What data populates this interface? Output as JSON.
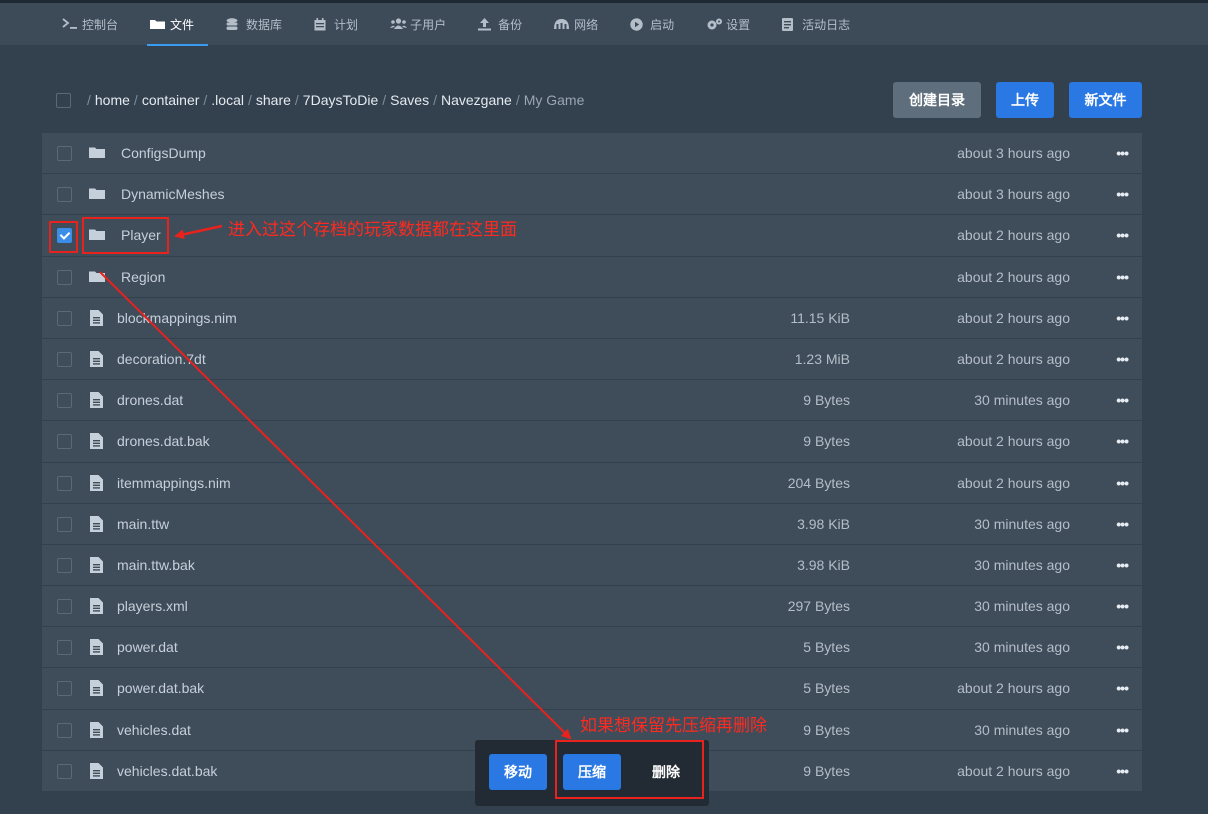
{
  "nav": [
    {
      "label": "控制台",
      "icon": "terminal-icon",
      "active": false
    },
    {
      "label": "文件",
      "icon": "folder-icon",
      "active": true
    },
    {
      "label": "数据库",
      "icon": "database-icon",
      "active": false
    },
    {
      "label": "计划",
      "icon": "calendar-icon",
      "active": false
    },
    {
      "label": "子用户",
      "icon": "users-icon",
      "active": false
    },
    {
      "label": "备份",
      "icon": "upload-icon",
      "active": false
    },
    {
      "label": "网络",
      "icon": "network-icon",
      "active": false
    },
    {
      "label": "启动",
      "icon": "play-icon",
      "active": false
    },
    {
      "label": "设置",
      "icon": "gears-icon",
      "active": false
    },
    {
      "label": "活动日志",
      "icon": "log-icon",
      "active": false
    }
  ],
  "breadcrumb": {
    "root": "/",
    "segments": [
      "home",
      "container",
      ".local",
      "share",
      "7DaysToDie",
      "Saves",
      "Navezgane"
    ],
    "current": "My Game"
  },
  "buttons": {
    "mkdir": "创建目录",
    "upload": "上传",
    "new_file": "新文件"
  },
  "files": [
    {
      "name": "ConfigsDump",
      "type": "folder",
      "size": "",
      "modified": "about 3 hours ago",
      "checked": false
    },
    {
      "name": "DynamicMeshes",
      "type": "folder",
      "size": "",
      "modified": "about 3 hours ago",
      "checked": false
    },
    {
      "name": "Player",
      "type": "folder",
      "size": "",
      "modified": "about 2 hours ago",
      "checked": true
    },
    {
      "name": "Region",
      "type": "folder",
      "size": "",
      "modified": "about 2 hours ago",
      "checked": false
    },
    {
      "name": "blockmappings.nim",
      "type": "file",
      "size": "11.15 KiB",
      "modified": "about 2 hours ago",
      "checked": false
    },
    {
      "name": "decoration.7dt",
      "type": "file",
      "size": "1.23 MiB",
      "modified": "about 2 hours ago",
      "checked": false
    },
    {
      "name": "drones.dat",
      "type": "file",
      "size": "9 Bytes",
      "modified": "30 minutes ago",
      "checked": false
    },
    {
      "name": "drones.dat.bak",
      "type": "file",
      "size": "9 Bytes",
      "modified": "about 2 hours ago",
      "checked": false
    },
    {
      "name": "itemmappings.nim",
      "type": "file",
      "size": "204 Bytes",
      "modified": "about 2 hours ago",
      "checked": false
    },
    {
      "name": "main.ttw",
      "type": "file",
      "size": "3.98 KiB",
      "modified": "30 minutes ago",
      "checked": false
    },
    {
      "name": "main.ttw.bak",
      "type": "file",
      "size": "3.98 KiB",
      "modified": "30 minutes ago",
      "checked": false
    },
    {
      "name": "players.xml",
      "type": "file",
      "size": "297 Bytes",
      "modified": "30 minutes ago",
      "checked": false
    },
    {
      "name": "power.dat",
      "type": "file",
      "size": "5 Bytes",
      "modified": "30 minutes ago",
      "checked": false
    },
    {
      "name": "power.dat.bak",
      "type": "file",
      "size": "5 Bytes",
      "modified": "about 2 hours ago",
      "checked": false
    },
    {
      "name": "vehicles.dat",
      "type": "file",
      "size": "9 Bytes",
      "modified": "30 minutes ago",
      "checked": false
    },
    {
      "name": "vehicles.dat.bak",
      "type": "file",
      "size": "9 Bytes",
      "modified": "about 2 hours ago",
      "checked": false
    }
  ],
  "row_more": "•••",
  "actions": {
    "move": "移动",
    "compress": "压缩",
    "delete": "删除"
  },
  "annotations": {
    "player_note": "进入过这个存档的玩家数据都在这里面",
    "compress_note": "如果想保留先压缩再删除"
  },
  "colors": {
    "accent": "#2a78e4",
    "annotation": "#e8221d",
    "background": "#33404d",
    "row": "#3f4c5a"
  }
}
